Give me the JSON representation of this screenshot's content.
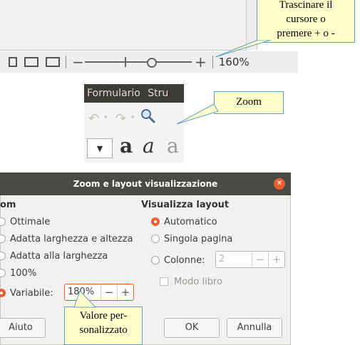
{
  "statusbar": {
    "zoom_minus": "−",
    "zoom_plus": "+",
    "zoom_percent": "160%",
    "slider_level_fraction": 0.62
  },
  "callouts": {
    "slider_note": [
      "Trascinare il",
      "cursore o",
      "premere + o -"
    ],
    "zoom_note": "Zoom",
    "custom_note": [
      "Valore per-",
      "sonalizzato"
    ],
    "color": "#ffffcc"
  },
  "toolbar": {
    "menu_items": [
      "Formulario",
      "Stru"
    ],
    "icons": [
      "undo-icon",
      "redo-icon",
      "zoom-magnifier-icon"
    ],
    "font_dropdown_arrow": "▼",
    "font_glyphs": [
      "a",
      "a",
      "a"
    ]
  },
  "dialog": {
    "title": "Zoom e layout visualizzazione",
    "zoom_section": "om",
    "zoom_options": [
      {
        "label": "Ottimale",
        "selected": false
      },
      {
        "label": "Adatta larghezza e altezza",
        "selected": false
      },
      {
        "label": "Adatta alla larghezza",
        "selected": false
      },
      {
        "label": "100%",
        "selected": false
      },
      {
        "label": "Variabile:",
        "selected": true
      }
    ],
    "variable_value": "180%",
    "layout_section": "Visualizza layout",
    "layout_options": [
      {
        "label": "Automatico",
        "selected": true
      },
      {
        "label": "Singola pagina",
        "selected": false
      },
      {
        "label": "Colonne:",
        "selected": false
      }
    ],
    "columns_value": "2",
    "book_mode_label": "Modo libro",
    "help_button": "Aiuto",
    "ok_button": "OK",
    "cancel_button": "Annulla",
    "accent_color": "#e9602f"
  }
}
